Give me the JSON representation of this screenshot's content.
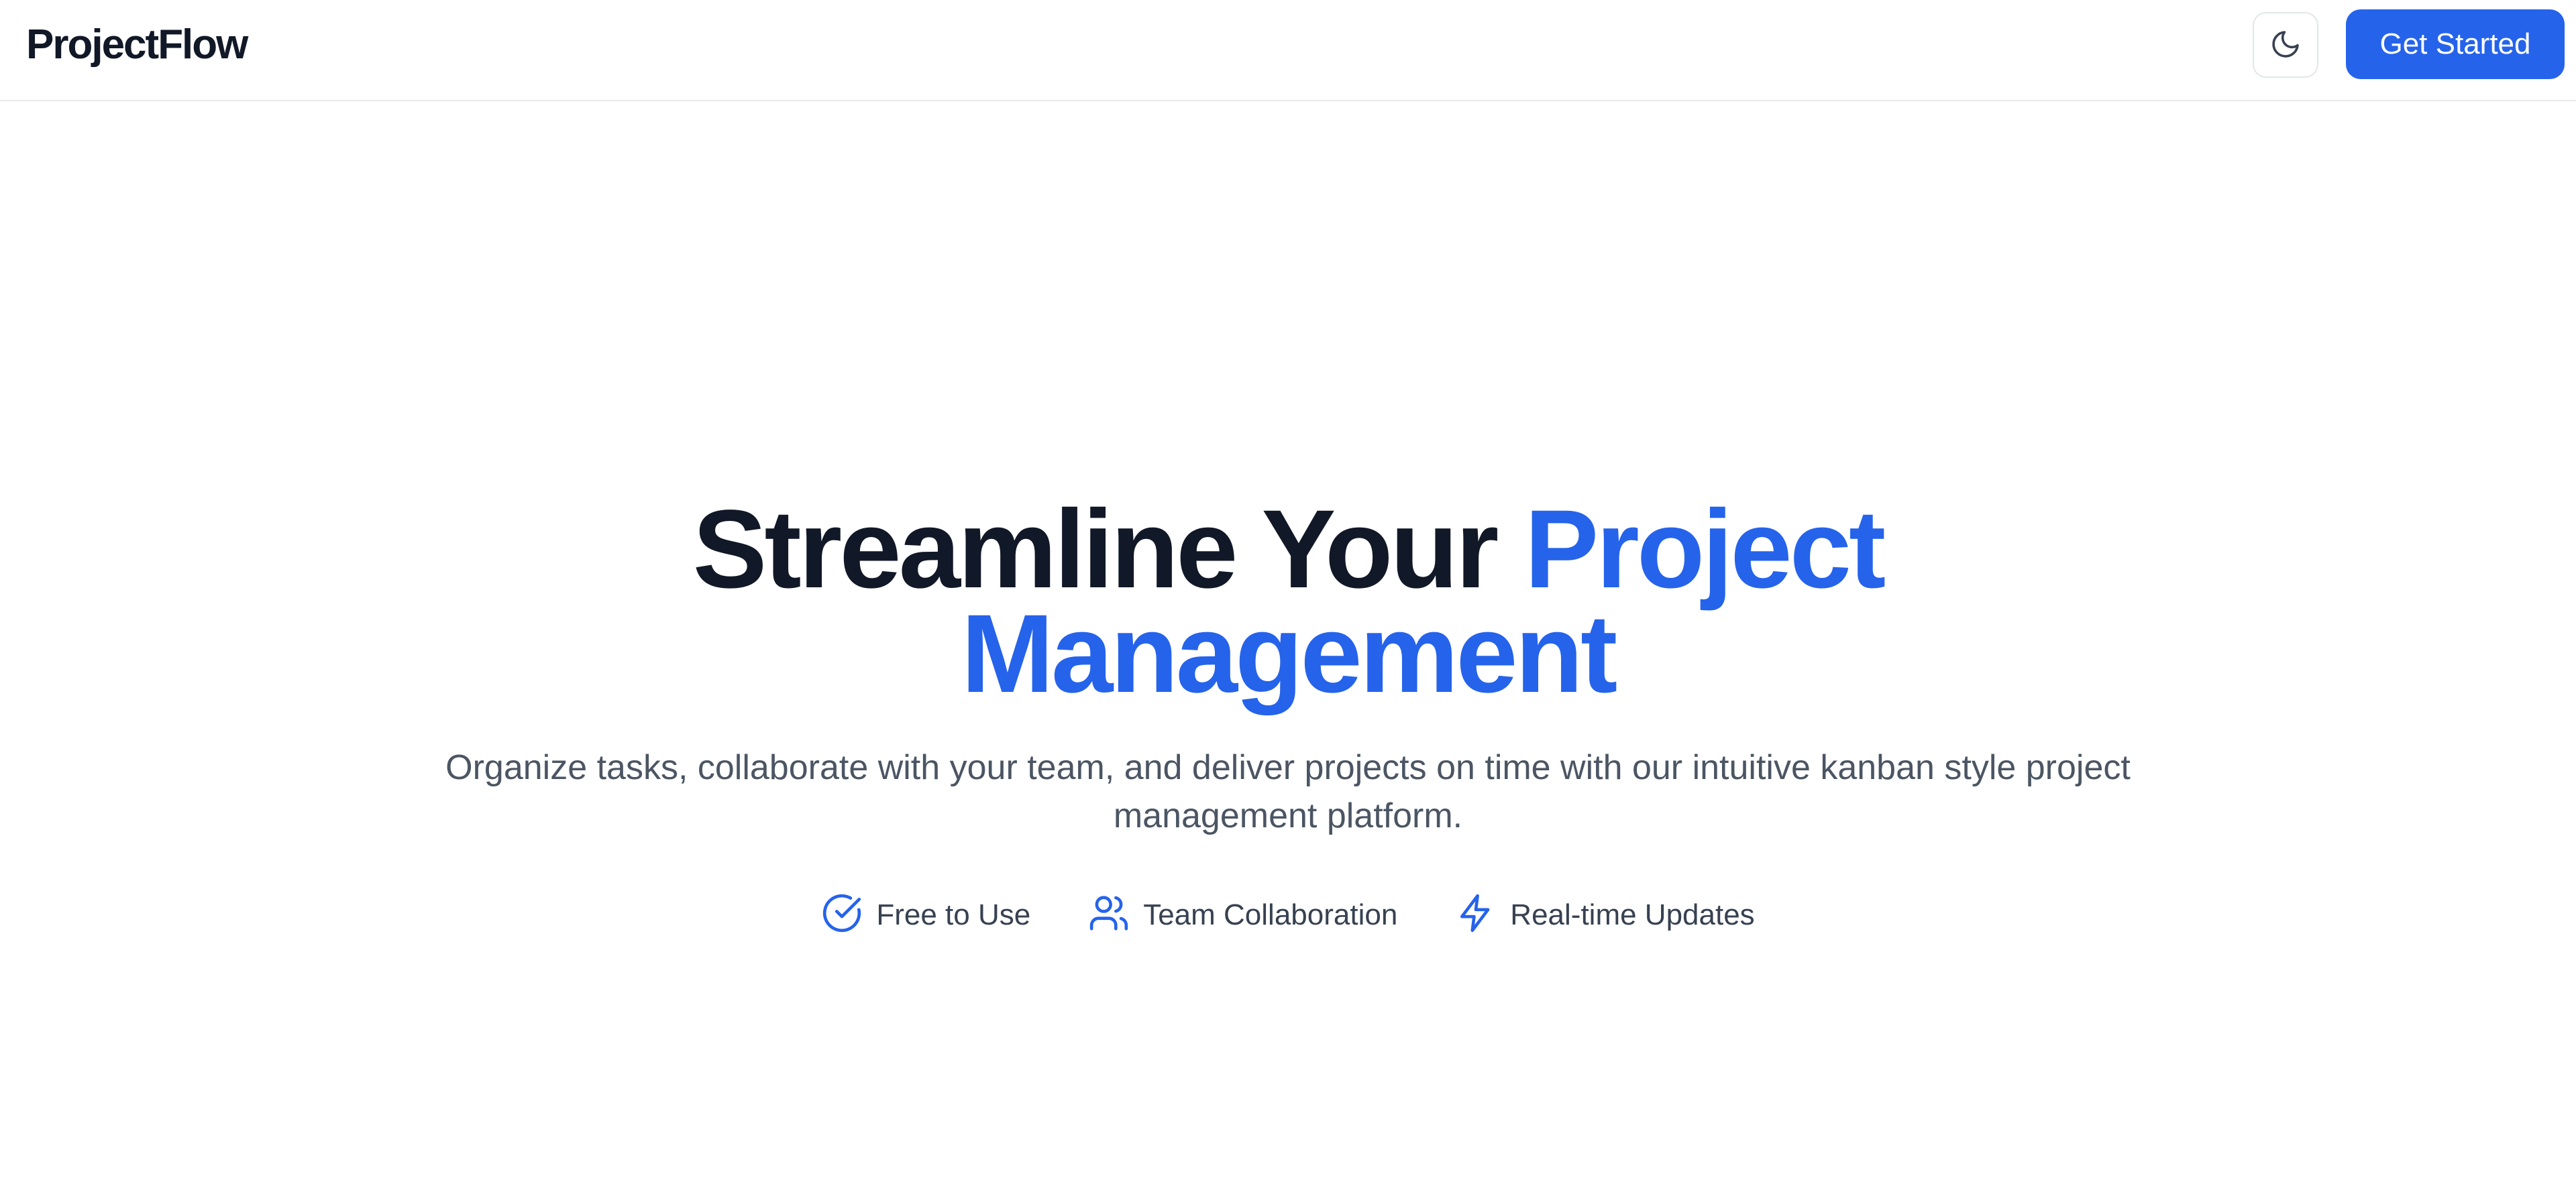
{
  "colors": {
    "accent": "#2563eb",
    "heading": "#111827",
    "body_text": "#4b5563",
    "border": "#e5e7eb"
  },
  "header": {
    "brand": "ProjectFlow",
    "theme_toggle_icon": "moon-icon",
    "cta_label": "Get Started"
  },
  "hero": {
    "title_part1": "Streamline Your",
    "title_accent_line1": "Project",
    "title_accent_line2": "Management",
    "subtitle": "Organize tasks, collaborate with your team, and deliver projects on time with our intuitive kanban style project management platform.",
    "features": [
      {
        "icon": "check-circle-icon",
        "label": "Free to Use"
      },
      {
        "icon": "users-icon",
        "label": "Team Collaboration"
      },
      {
        "icon": "lightning-icon",
        "label": "Real-time Updates"
      }
    ]
  }
}
